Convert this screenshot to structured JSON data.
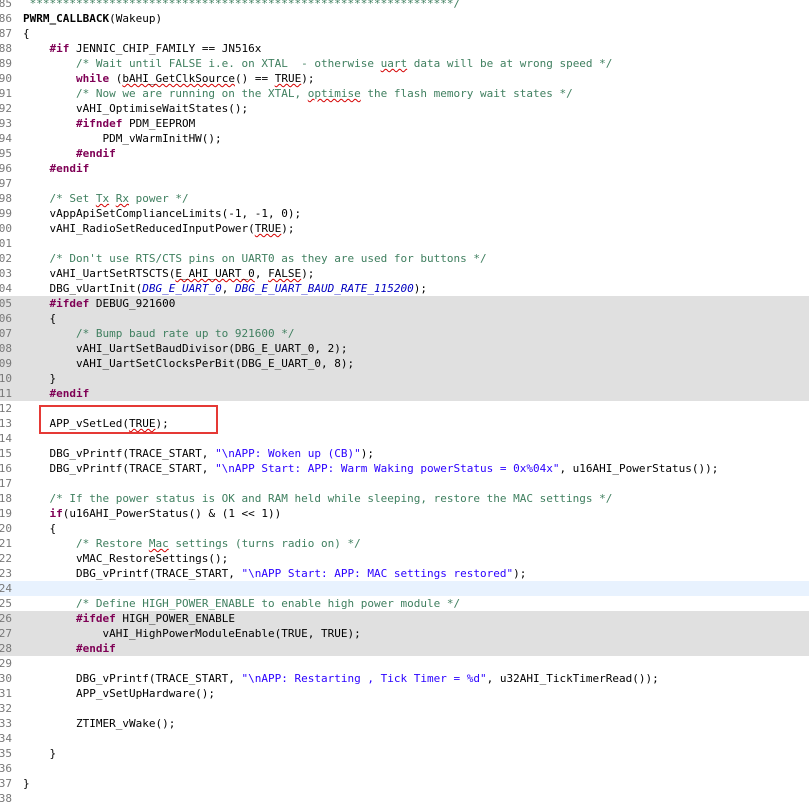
{
  "editor": {
    "first_line_number": 85,
    "lines": [
      {
        "ln": "85",
        "t": [
          {
            "c": "cm",
            "t": " ****************************************************************/"
          }
        ]
      },
      {
        "ln": "86",
        "t": [
          {
            "c": "fn",
            "t": "PWRM_CALLBACK"
          },
          {
            "t": "(Wakeup)"
          }
        ]
      },
      {
        "ln": "87",
        "t": [
          {
            "t": "{"
          }
        ]
      },
      {
        "ln": "88",
        "t": [
          {
            "t": "    "
          },
          {
            "c": "kw",
            "t": "#if"
          },
          {
            "t": " JENNIC_CHIP_FAMILY == JN516x"
          }
        ]
      },
      {
        "ln": "89",
        "t": [
          {
            "t": "        "
          },
          {
            "c": "cm",
            "t": "/* Wait until FALSE i.e. on XTAL  - otherwise "
          },
          {
            "c": "cm sq",
            "t": "uart"
          },
          {
            "c": "cm",
            "t": " data will be at wrong speed */"
          }
        ]
      },
      {
        "ln": "90",
        "t": [
          {
            "t": "        "
          },
          {
            "c": "kw",
            "t": "while"
          },
          {
            "t": " ("
          },
          {
            "c": "sq",
            "t": "bAHI_GetClkSource"
          },
          {
            "t": "() == "
          },
          {
            "c": "sq",
            "t": "TRUE"
          },
          {
            "t": ");"
          }
        ]
      },
      {
        "ln": "91",
        "t": [
          {
            "t": "        "
          },
          {
            "c": "cm",
            "t": "/* Now we are running on the XTAL, "
          },
          {
            "c": "cm sq",
            "t": "optimise"
          },
          {
            "c": "cm",
            "t": " the flash memory wait states */"
          }
        ]
      },
      {
        "ln": "92",
        "t": [
          {
            "t": "        vAHI_OptimiseWaitStates();"
          }
        ]
      },
      {
        "ln": "93",
        "t": [
          {
            "t": "        "
          },
          {
            "c": "kw",
            "t": "#ifndef"
          },
          {
            "t": " PDM_EEPROM"
          }
        ]
      },
      {
        "ln": "94",
        "t": [
          {
            "t": "            PDM_vWarmInitHW();"
          }
        ]
      },
      {
        "ln": "95",
        "t": [
          {
            "t": "        "
          },
          {
            "c": "kw",
            "t": "#endif"
          }
        ]
      },
      {
        "ln": "96",
        "t": [
          {
            "t": "    "
          },
          {
            "c": "kw",
            "t": "#endif"
          }
        ]
      },
      {
        "ln": "97",
        "t": []
      },
      {
        "ln": "98",
        "t": [
          {
            "t": "    "
          },
          {
            "c": "cm",
            "t": "/* Set "
          },
          {
            "c": "cm sq",
            "t": "Tx"
          },
          {
            "c": "cm",
            "t": " "
          },
          {
            "c": "cm sq",
            "t": "Rx"
          },
          {
            "c": "cm",
            "t": " power */"
          }
        ]
      },
      {
        "ln": "99",
        "t": [
          {
            "t": "    vAppApiSetComplianceLimits(-1, -1, 0);"
          }
        ]
      },
      {
        "ln": "00",
        "t": [
          {
            "t": "    vAHI_RadioSetReducedInputPower("
          },
          {
            "c": "sq",
            "t": "TRUE"
          },
          {
            "t": ");"
          }
        ]
      },
      {
        "ln": "01",
        "t": []
      },
      {
        "ln": "02",
        "t": [
          {
            "t": "    "
          },
          {
            "c": "cm",
            "t": "/* Don't use RTS/CTS pins on UART0 as they are used for buttons */"
          }
        ]
      },
      {
        "ln": "03",
        "t": [
          {
            "t": "    vAHI_UartSetRTSCTS("
          },
          {
            "c": "sq",
            "t": "E_AHI_UART_0"
          },
          {
            "t": ", "
          },
          {
            "c": "sq",
            "t": "FALSE"
          },
          {
            "t": ");"
          }
        ]
      },
      {
        "ln": "04",
        "t": [
          {
            "t": "    DBG_vUartInit("
          },
          {
            "c": "en",
            "t": "DBG_E_UART_0"
          },
          {
            "t": ", "
          },
          {
            "c": "en",
            "t": "DBG_E_UART_BAUD_RATE_115200"
          },
          {
            "t": ");"
          }
        ]
      },
      {
        "ln": "05",
        "hl": "grey",
        "t": [
          {
            "t": "    "
          },
          {
            "c": "kw",
            "t": "#ifdef"
          },
          {
            "t": " DEBUG_921600"
          }
        ]
      },
      {
        "ln": "06",
        "hl": "grey",
        "t": [
          {
            "t": "    {"
          }
        ]
      },
      {
        "ln": "07",
        "hl": "grey",
        "t": [
          {
            "t": "        "
          },
          {
            "c": "cm",
            "t": "/* Bump baud rate up to 921600 */"
          }
        ]
      },
      {
        "ln": "08",
        "hl": "grey",
        "t": [
          {
            "t": "        vAHI_UartSetBaudDivisor(DBG_E_UART_0, 2);"
          }
        ]
      },
      {
        "ln": "09",
        "hl": "grey",
        "t": [
          {
            "t": "        vAHI_UartSetClocksPerBit(DBG_E_UART_0, 8);"
          }
        ]
      },
      {
        "ln": "10",
        "hl": "grey",
        "t": [
          {
            "t": "    }"
          }
        ]
      },
      {
        "ln": "11",
        "hl": "grey",
        "t": [
          {
            "t": "    "
          },
          {
            "c": "kw",
            "t": "#endif"
          }
        ]
      },
      {
        "ln": "12",
        "t": []
      },
      {
        "ln": "13",
        "t": [
          {
            "t": "    APP_vSetLed("
          },
          {
            "c": "sq",
            "t": "TRUE"
          },
          {
            "t": ");"
          }
        ]
      },
      {
        "ln": "14",
        "t": []
      },
      {
        "ln": "15",
        "t": [
          {
            "t": "    DBG_vPrintf(TRACE_START, "
          },
          {
            "c": "st",
            "t": "\"\\nAPP: Woken up (CB)\""
          },
          {
            "t": ");"
          }
        ]
      },
      {
        "ln": "16",
        "t": [
          {
            "t": "    DBG_vPrintf(TRACE_START, "
          },
          {
            "c": "st",
            "t": "\"\\nAPP Start: APP: Warm Waking powerStatus = 0x%04x\""
          },
          {
            "t": ", u16AHI_PowerStatus());"
          }
        ]
      },
      {
        "ln": "17",
        "t": []
      },
      {
        "ln": "18",
        "t": [
          {
            "t": "    "
          },
          {
            "c": "cm",
            "t": "/* If the power status is OK and RAM held while sleeping, restore the MAC settings */"
          }
        ]
      },
      {
        "ln": "19",
        "t": [
          {
            "t": "    "
          },
          {
            "c": "kw",
            "t": "if"
          },
          {
            "t": "(u16AHI_PowerStatus() & (1 << 1))"
          }
        ]
      },
      {
        "ln": "20",
        "t": [
          {
            "t": "    {"
          }
        ]
      },
      {
        "ln": "21",
        "t": [
          {
            "t": "        "
          },
          {
            "c": "cm",
            "t": "/* Restore "
          },
          {
            "c": "cm sq",
            "t": "Mac"
          },
          {
            "c": "cm",
            "t": " settings (turns radio on) */"
          }
        ]
      },
      {
        "ln": "22",
        "t": [
          {
            "t": "        vMAC_RestoreSettings();"
          }
        ]
      },
      {
        "ln": "23",
        "t": [
          {
            "t": "        DBG_vPrintf(TRACE_START, "
          },
          {
            "c": "st",
            "t": "\"\\nAPP Start: APP: MAC settings restored\""
          },
          {
            "t": ");"
          }
        ]
      },
      {
        "ln": "24",
        "hl": "cur",
        "t": []
      },
      {
        "ln": "25",
        "t": [
          {
            "t": "        "
          },
          {
            "c": "cm",
            "t": "/* Define HIGH_POWER_ENABLE to enable high power module */"
          }
        ]
      },
      {
        "ln": "26",
        "hl": "grey",
        "t": [
          {
            "t": "        "
          },
          {
            "c": "kw",
            "t": "#ifdef"
          },
          {
            "t": " HIGH_POWER_ENABLE"
          }
        ]
      },
      {
        "ln": "27",
        "hl": "grey",
        "t": [
          {
            "t": "            vAHI_HighPowerModuleEnable(TRUE, TRUE);"
          }
        ]
      },
      {
        "ln": "28",
        "hl": "grey",
        "t": [
          {
            "t": "        "
          },
          {
            "c": "kw",
            "t": "#endif"
          }
        ]
      },
      {
        "ln": "29",
        "t": []
      },
      {
        "ln": "30",
        "t": [
          {
            "t": "        DBG_vPrintf(TRACE_START, "
          },
          {
            "c": "st",
            "t": "\"\\nAPP: Restarting , Tick Timer = %d\""
          },
          {
            "t": ", u32AHI_TickTimerRead());"
          }
        ]
      },
      {
        "ln": "31",
        "t": [
          {
            "t": "        APP_vSetUpHardware();"
          }
        ]
      },
      {
        "ln": "32",
        "t": []
      },
      {
        "ln": "33",
        "t": [
          {
            "t": "        ZTIMER_vWake();"
          }
        ]
      },
      {
        "ln": "34",
        "t": []
      },
      {
        "ln": "35",
        "t": [
          {
            "t": "    }"
          }
        ]
      },
      {
        "ln": "36",
        "t": []
      },
      {
        "ln": "37",
        "t": [
          {
            "t": "}"
          }
        ]
      },
      {
        "ln": "38",
        "t": []
      }
    ]
  },
  "annotation": {
    "color": "#e53935",
    "target": "APP_vSetLed(TRUE);"
  },
  "colors": {
    "keyword": "#7f0055",
    "comment": "#3f7f5f",
    "string": "#2a00ff",
    "enum": "#0000c0",
    "line_number": "#787878",
    "highlight_grey": "#e0e0e0",
    "current_line": "#e8f2fe"
  }
}
